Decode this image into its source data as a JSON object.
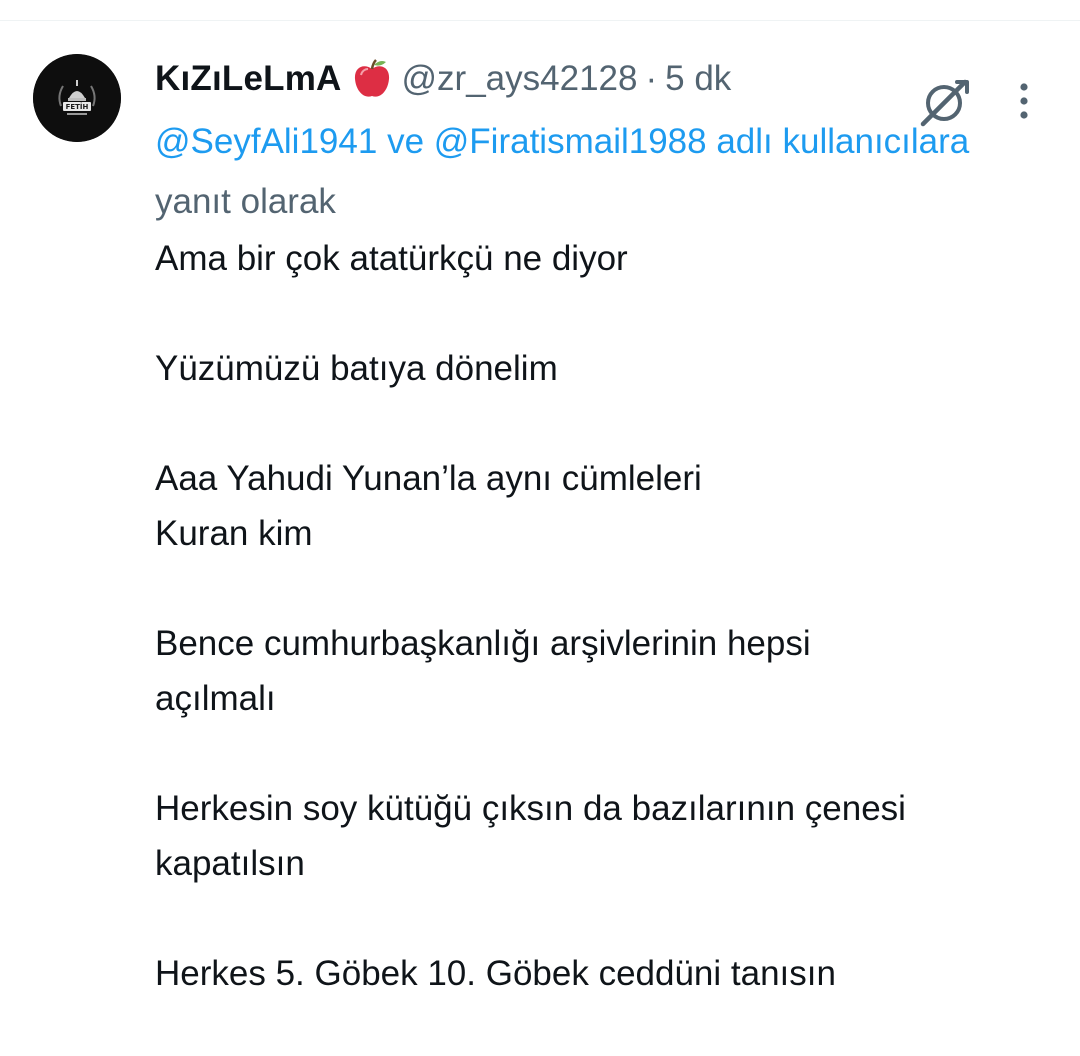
{
  "tweet": {
    "display_name": "KıZıLeLmA",
    "name_emoji": "🍎",
    "handle": "@zr_ays42128",
    "separator": "·",
    "time": "5 dk",
    "reply_context": {
      "mention_1": "@SeyfAli1941",
      "conjunction": "ve",
      "mention_2": "@Firatismail1988",
      "suffix_link": "adlı kullanıcılara",
      "suffix_text": "yanıt olarak"
    },
    "paragraphs": [
      [
        "Ama bir çok atatürkçü ne diyor"
      ],
      [
        "Yüzümüzü batıya dönelim"
      ],
      [
        "Aaa Yahudi Yunan’la aynı cümleleri",
        "Kuran kim"
      ],
      [
        "Bence cumhurbaşkanlığı arşivlerinin hepsi",
        "açılmalı"
      ],
      [
        "Herkesin soy kütüğü çıksın da bazılarının çenesi",
        "kapatılsın"
      ],
      [
        "Herkes 5. Göbek 10. Göbek ceddüni tanısın"
      ]
    ],
    "avatar_text": "FETİH"
  },
  "icons": {
    "grok": "grok-icon",
    "more": "more-dots-icon",
    "apple": "red-apple-icon"
  },
  "colors": {
    "text": "#0f1419",
    "secondary": "#536471",
    "link": "#1d9bf0",
    "divider": "#eff3f4"
  }
}
